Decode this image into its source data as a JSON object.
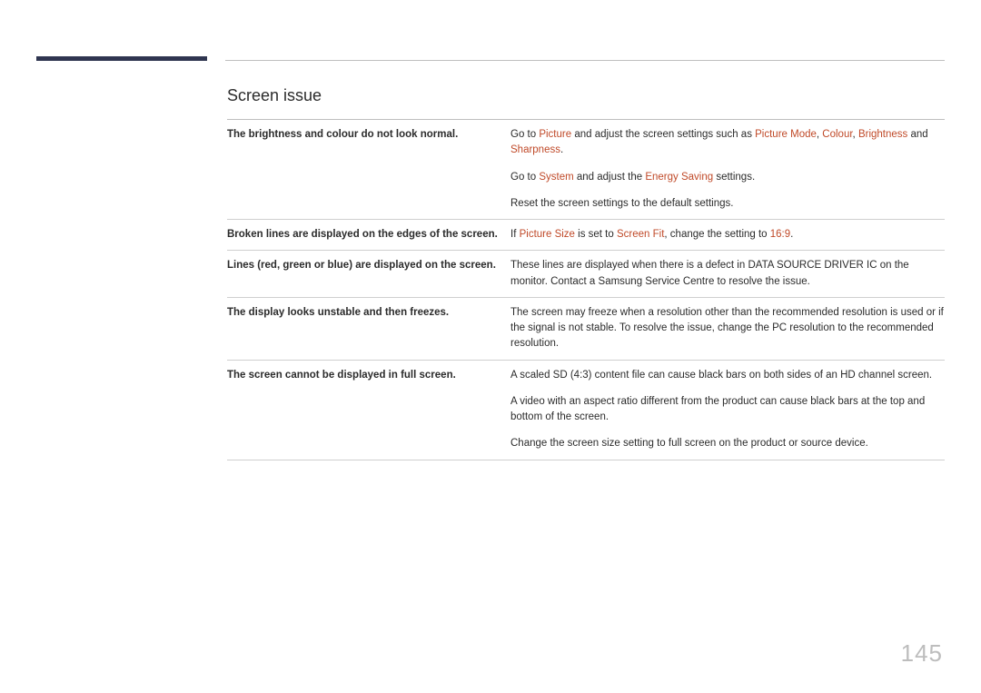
{
  "section_title": "Screen issue",
  "page_number": "145",
  "rows": [
    {
      "issue": "The brightness and colour do not look normal.",
      "sol_segments": [
        {
          "t": "Go to "
        },
        {
          "t": "Picture",
          "hl": true
        },
        {
          "t": " and adjust the screen settings such as "
        },
        {
          "t": "Picture Mode",
          "hl": true
        },
        {
          "t": ", "
        },
        {
          "t": "Colour",
          "hl": true
        },
        {
          "t": ", "
        },
        {
          "t": "Brightness",
          "hl": true
        },
        {
          "t": " and "
        },
        {
          "t": "Sharpness",
          "hl": true
        },
        {
          "t": "."
        }
      ]
    },
    {
      "continuation": true,
      "issue": "",
      "sol_segments": [
        {
          "t": "Go to "
        },
        {
          "t": "System",
          "hl": true
        },
        {
          "t": " and adjust the "
        },
        {
          "t": "Energy Saving",
          "hl": true
        },
        {
          "t": " settings."
        }
      ]
    },
    {
      "continuation": true,
      "issue": "",
      "sol_segments": [
        {
          "t": "Reset the screen settings to the default settings."
        }
      ]
    },
    {
      "issue": "Broken lines are displayed on the edges of the screen.",
      "sol_segments": [
        {
          "t": "If "
        },
        {
          "t": "Picture Size",
          "hl": true
        },
        {
          "t": " is set to "
        },
        {
          "t": "Screen Fit",
          "hl": true
        },
        {
          "t": ", change the setting to "
        },
        {
          "t": "16:9",
          "hl": true
        },
        {
          "t": "."
        }
      ]
    },
    {
      "issue": "Lines (red, green or blue) are displayed on the screen.",
      "sol_segments": [
        {
          "t": "These lines are displayed when there is a defect in DATA SOURCE DRIVER IC on the monitor. Contact a Samsung Service Centre to resolve the issue."
        }
      ]
    },
    {
      "issue": "The display looks unstable and then freezes.",
      "sol_segments": [
        {
          "t": "The screen may freeze when a resolution other than the recommended resolution is used or if the signal is not stable. To resolve the issue, change the PC resolution to the recommended resolution."
        }
      ]
    },
    {
      "issue": "The screen cannot be displayed in full screen.",
      "sol_segments": [
        {
          "t": "A scaled SD (4:3) content file can cause black bars on both sides of an HD channel screen."
        }
      ]
    },
    {
      "continuation": true,
      "issue": "",
      "sol_segments": [
        {
          "t": "A video with an aspect ratio different from the product can cause black bars at the top and bottom of the screen."
        }
      ]
    },
    {
      "continuation": true,
      "last": true,
      "issue": "",
      "sol_segments": [
        {
          "t": "Change the screen size setting to full screen on the product or source device."
        }
      ]
    }
  ]
}
